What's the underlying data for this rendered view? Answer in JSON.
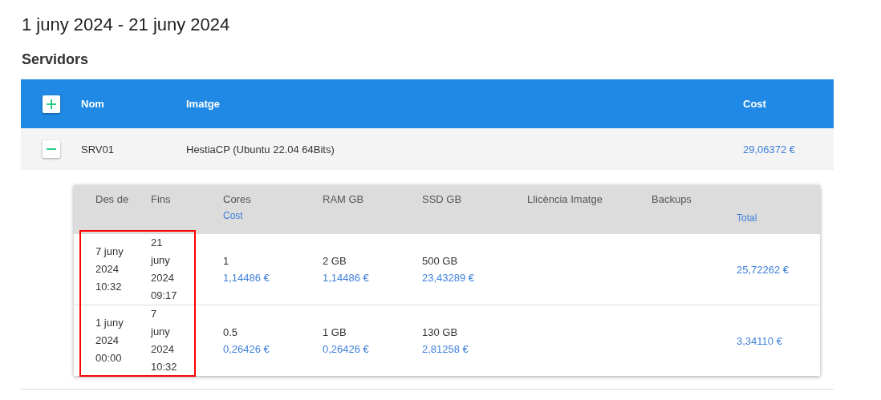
{
  "title": "1 juny 2024 - 21 juny 2024",
  "section": "Servidors",
  "table": {
    "columns": [
      "Nom",
      "Imatge",
      "Cost"
    ],
    "rows": [
      {
        "name": "SRV01",
        "image": "HestiaCP (Ubuntu 22.04 64Bits)",
        "cost": "29,06372 €",
        "expanded": true,
        "details": {
          "highlight_dates": true,
          "columns": [
            {
              "label": "Des de"
            },
            {
              "label": "Fins"
            },
            {
              "label": "Cores",
              "sublabel": "Cost"
            },
            {
              "label": "RAM GB"
            },
            {
              "label": "SSD GB"
            },
            {
              "label": "Llicència Imatge"
            },
            {
              "label": "Backups"
            },
            {
              "sublabel": "Total"
            }
          ],
          "rows": [
            {
              "from": "7 juny 2024 10:32",
              "to": "21 juny 2024 09:17",
              "cores": {
                "value": "1",
                "cost": "1,14486 €"
              },
              "ram": {
                "value": "2 GB",
                "cost": "1,14486 €"
              },
              "ssd": {
                "value": "500 GB",
                "cost": "23,43289 €"
              },
              "total": "25,72262 €"
            },
            {
              "from": "1 juny 2024 00:00",
              "to": "7 juny 2024 10:32",
              "cores": {
                "value": "0.5",
                "cost": "0,26426 €"
              },
              "ram": {
                "value": "1 GB",
                "cost": "0,26426 €"
              },
              "ssd": {
                "value": "130 GB",
                "cost": "2,81258 €"
              },
              "total": "3,34110 €"
            }
          ]
        }
      }
    ]
  }
}
